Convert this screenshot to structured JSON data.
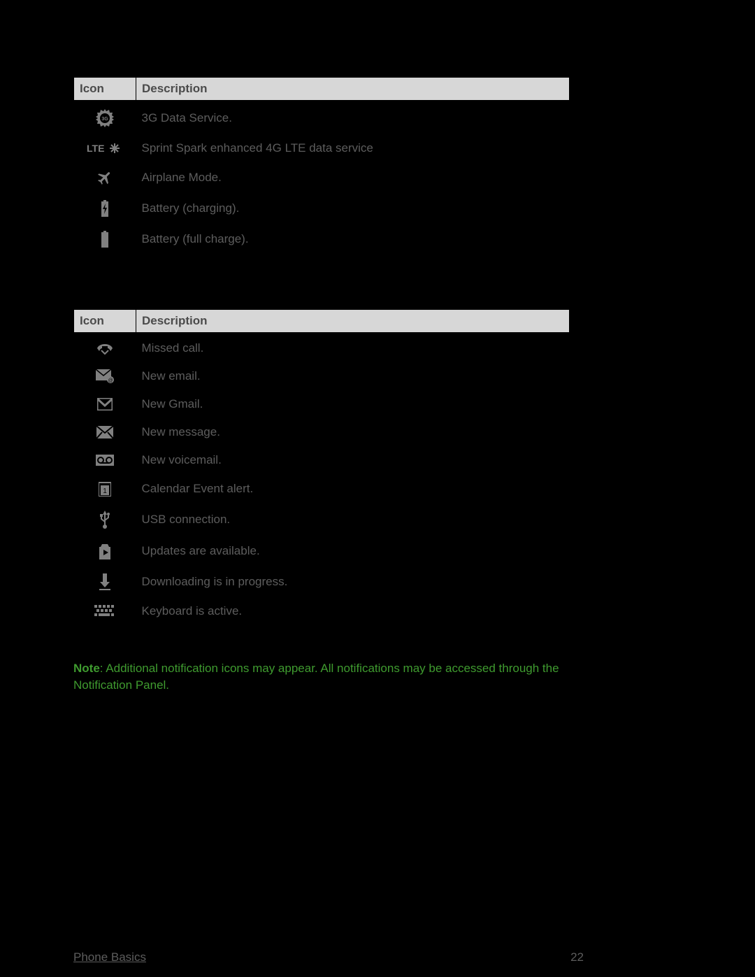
{
  "section1": {
    "header_icon": "Icon",
    "header_desc": "Description",
    "rows": [
      {
        "icon": "3g-icon",
        "desc": "3G Data Service."
      },
      {
        "icon": "lte-spark-icon",
        "desc": "Sprint Spark enhanced 4G LTE data service"
      },
      {
        "icon": "airplane-icon",
        "desc": "Airplane Mode."
      },
      {
        "icon": "battery-charging-icon",
        "desc": "Battery (charging)."
      },
      {
        "icon": "battery-full-icon",
        "desc": "Battery (full charge)."
      }
    ]
  },
  "section2": {
    "header_icon": "Icon",
    "header_desc": "Description",
    "rows": [
      {
        "icon": "missed-call-icon",
        "desc": "Missed call."
      },
      {
        "icon": "new-email-icon",
        "desc": "New email."
      },
      {
        "icon": "new-gmail-icon",
        "desc": "New Gmail."
      },
      {
        "icon": "new-message-icon",
        "desc": "New message."
      },
      {
        "icon": "new-voicemail-icon",
        "desc": "New voicemail."
      },
      {
        "icon": "calendar-event-icon",
        "desc": "Calendar Event alert."
      },
      {
        "icon": "usb-icon",
        "desc": "USB connection."
      },
      {
        "icon": "updates-icon",
        "desc": "Updates are available."
      },
      {
        "icon": "download-icon",
        "desc": "Downloading is in progress."
      },
      {
        "icon": "keyboard-icon",
        "desc": "Keyboard is active."
      }
    ]
  },
  "note_bold": "Note",
  "note_text": ": Additional notification icons may appear. All notifications may be accessed through the Notification Panel.",
  "footer_left": "Phone Basics",
  "footer_right": "22"
}
